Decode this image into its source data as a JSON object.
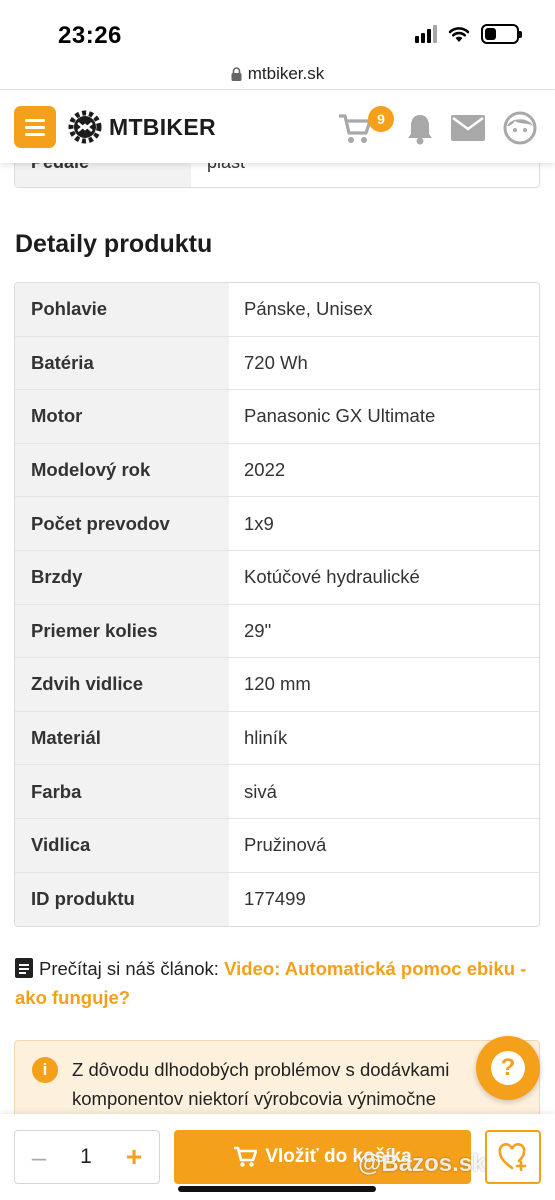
{
  "status_bar": {
    "time": "23:26"
  },
  "browser": {
    "url": "mtbiker.sk"
  },
  "header": {
    "logo_text": "MTBIKER",
    "cart_count": "9"
  },
  "prev_row": {
    "label": "Pedále",
    "value": "plast"
  },
  "details": {
    "title": "Detaily produktu",
    "rows": [
      {
        "label": "Pohlavie",
        "value": "Pánske, Unisex"
      },
      {
        "label": "Batéria",
        "value": "720 Wh"
      },
      {
        "label": "Motor",
        "value": "Panasonic GX Ultimate"
      },
      {
        "label": "Modelový rok",
        "value": "2022"
      },
      {
        "label": "Počet prevodov",
        "value": "1x9"
      },
      {
        "label": "Brzdy",
        "value": "Kotúčové hydraulické"
      },
      {
        "label": "Priemer kolies",
        "value": "29\""
      },
      {
        "label": "Zdvih vidlice",
        "value": "120 mm"
      },
      {
        "label": "Materiál",
        "value": "hliník"
      },
      {
        "label": "Farba",
        "value": "sivá"
      },
      {
        "label": "Vidlica",
        "value": "Pružinová"
      },
      {
        "label": "ID produktu",
        "value": "177499"
      }
    ]
  },
  "article": {
    "prefix": "Prečítaj si náš článok:",
    "link": "Video: Automatická pomoc ebiku - ako funguje?"
  },
  "notice": {
    "text": "Z dôvodu dlhodobých problémov s dodávkami komponentov niektorí výrobcovia výnimočne"
  },
  "bottom_bar": {
    "quantity": "1",
    "add_to_cart_label": "Vložiť do košíka"
  },
  "watermark": "@Bazos.sk",
  "colors": {
    "accent": "#f5a01a",
    "icon_gray": "#a8a8a8"
  }
}
